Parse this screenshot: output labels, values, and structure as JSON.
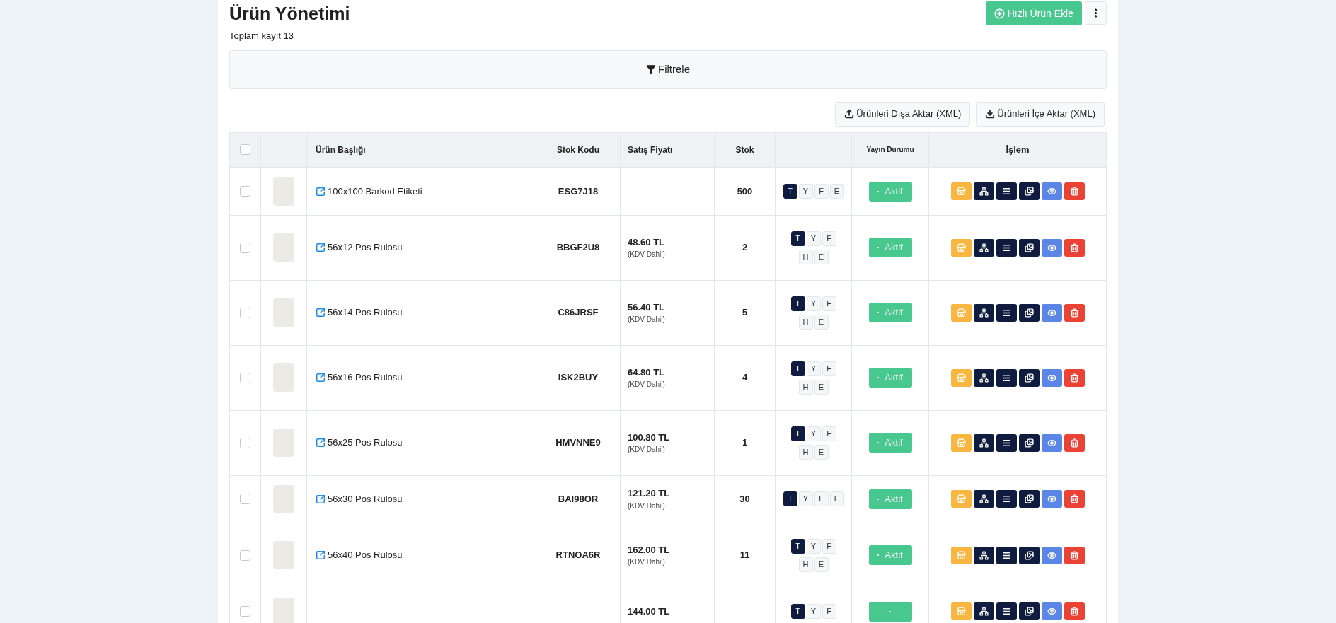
{
  "header": {
    "title": "Ürün Yönetimi",
    "subtitle": "Toplam kayıt 13",
    "add_button": "Hızlı Ürün Ekle"
  },
  "filter": {
    "label": "Filtrele"
  },
  "export_buttons": [
    {
      "kind": "export",
      "label": "Ürünleri Dışa Aktar (XML)"
    },
    {
      "kind": "import",
      "label": "Ürünleri İçe Aktar (XML)"
    }
  ],
  "table": {
    "select_all": {
      "checked": false
    },
    "columns": {
      "title": "Ürün Başlığı",
      "code": "Stok Kodu",
      "price": "Satış Fiyatı",
      "stock": "Stok",
      "status": "Yayın Durumu",
      "actions": "İşlem"
    },
    "rows": [
      {
        "checked": false,
        "title": "100x100 Barkod Etiketi",
        "code": "ESG7J18",
        "stock": "500",
        "tags": [
          {
            "label": "T",
            "selected": true
          },
          {
            "label": "Y",
            "selected": false
          },
          {
            "label": "F",
            "selected": false
          },
          {
            "label": "E",
            "selected": false
          }
        ],
        "status": {
          "label": "Aktif",
          "active": true
        }
      },
      {
        "checked": false,
        "title": "56x12 Pos Rulosu",
        "code": "BBGF2U8",
        "price": "48.60 TL",
        "price_note": "(KDV Dahil)",
        "stock": "2",
        "tags": [
          {
            "label": "T",
            "selected": true
          },
          {
            "label": "Y",
            "selected": false
          },
          {
            "label": "F",
            "selected": false
          },
          {
            "label": "H",
            "selected": false
          },
          {
            "label": "E",
            "selected": false
          }
        ],
        "status": {
          "label": "Aktif",
          "active": true
        }
      },
      {
        "checked": false,
        "title": "56x14 Pos Rulosu",
        "code": "C86JRSF",
        "price": "56.40 TL",
        "price_note": "(KDV Dahil)",
        "stock": "5",
        "tags": [
          {
            "label": "T",
            "selected": true
          },
          {
            "label": "Y",
            "selected": false
          },
          {
            "label": "F",
            "selected": false
          },
          {
            "label": "H",
            "selected": false
          },
          {
            "label": "E",
            "selected": false
          }
        ],
        "status": {
          "label": "Aktif",
          "active": true
        }
      },
      {
        "checked": false,
        "title": "56x16 Pos Rulosu",
        "code": "ISK2BUY",
        "price": "64.80 TL",
        "price_note": "(KDV Dahil)",
        "stock": "4",
        "tags": [
          {
            "label": "T",
            "selected": true
          },
          {
            "label": "Y",
            "selected": false
          },
          {
            "label": "F",
            "selected": false
          },
          {
            "label": "H",
            "selected": false
          },
          {
            "label": "E",
            "selected": false
          }
        ],
        "status": {
          "label": "Aktif",
          "active": true
        }
      },
      {
        "checked": false,
        "title": "56x25 Pos Rulosu",
        "code": "HMVNNE9",
        "price": "100.80 TL",
        "price_note": "(KDV Dahil)",
        "stock": "1",
        "tags": [
          {
            "label": "T",
            "selected": true
          },
          {
            "label": "Y",
            "selected": false
          },
          {
            "label": "F",
            "selected": false
          },
          {
            "label": "H",
            "selected": false
          },
          {
            "label": "E",
            "selected": false
          }
        ],
        "status": {
          "label": "Aktif",
          "active": true
        }
      },
      {
        "checked": false,
        "title": "56x30 Pos Rulosu",
        "code": "BAI98OR",
        "price": "121.20 TL",
        "price_note": "(KDV Dahil)",
        "stock": "30",
        "tags": [
          {
            "label": "T",
            "selected": true
          },
          {
            "label": "Y",
            "selected": false
          },
          {
            "label": "F",
            "selected": false
          },
          {
            "label": "E",
            "selected": false
          }
        ],
        "status": {
          "label": "Aktif",
          "active": true
        }
      },
      {
        "checked": false,
        "title": "56x40 Pos Rulosu",
        "code": "RTNOA6R",
        "price": "162.00 TL",
        "price_note": "(KDV Dahil)",
        "stock": "11",
        "tags": [
          {
            "label": "T",
            "selected": true
          },
          {
            "label": "Y",
            "selected": false
          },
          {
            "label": "F",
            "selected": false
          },
          {
            "label": "H",
            "selected": false
          },
          {
            "label": "E",
            "selected": false
          }
        ],
        "status": {
          "label": "Aktif",
          "active": true
        }
      },
      {
        "checked": false,
        "price": "144.00 TL",
        "tags": [
          {
            "label": "T",
            "selected": true
          },
          {
            "label": "Y",
            "selected": false
          },
          {
            "label": "F",
            "selected": false
          }
        ],
        "status": {
          "active": true
        }
      }
    ]
  }
}
